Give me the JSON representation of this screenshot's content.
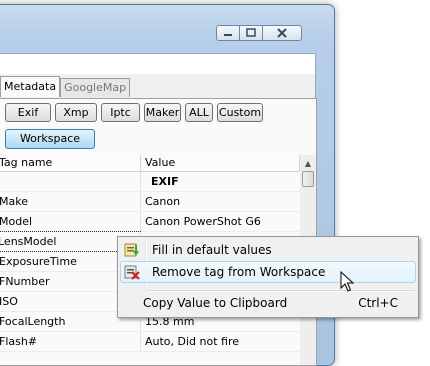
{
  "window": {
    "caption_buttons": [
      "minimize-icon",
      "maximize-icon",
      "close-icon"
    ]
  },
  "tabs": [
    {
      "label": "Metadata",
      "active": true
    },
    {
      "label": "GoogleMap",
      "active": false
    }
  ],
  "filter_buttons": [
    "Exif",
    "Xmp",
    "Iptc",
    "Maker",
    "ALL",
    "Custom"
  ],
  "workspace_button": "Workspace",
  "table": {
    "headers": [
      "Tag name",
      "Value"
    ],
    "rows": [
      {
        "tag": "",
        "value": "EXIF"
      },
      {
        "tag": "Make",
        "value": "Canon"
      },
      {
        "tag": "Model",
        "value": "Canon PowerShot G6"
      },
      {
        "tag": "LensModel",
        "value": ""
      },
      {
        "tag": "ExposureTime",
        "value": ""
      },
      {
        "tag": "FNumber",
        "value": ""
      },
      {
        "tag": "ISO",
        "value": ""
      },
      {
        "tag": "FocalLength",
        "value": "15.8 mm"
      },
      {
        "tag": "Flash#",
        "value": "Auto, Did not fire"
      }
    ]
  },
  "context_menu": {
    "items": [
      {
        "label": "Fill in default values",
        "icon": "fill-defaults-icon",
        "shortcut": ""
      },
      {
        "label": "Remove tag from Workspace",
        "icon": "remove-tag-icon",
        "shortcut": "",
        "highlighted": true
      },
      {
        "label": "Copy Value to Clipboard",
        "icon": "",
        "shortcut": "Ctrl+C"
      }
    ]
  }
}
